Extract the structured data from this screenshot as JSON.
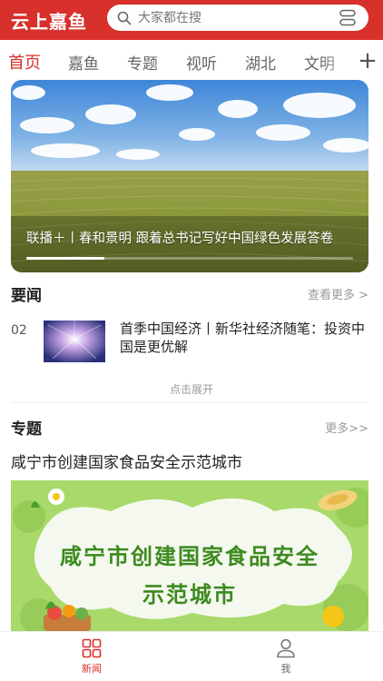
{
  "header": {
    "app_title": "云上嘉鱼",
    "search_placeholder": "大家都在搜",
    "brand_color": "#d8302b"
  },
  "tabs": [
    {
      "label": "首页",
      "active": true
    },
    {
      "label": "嘉鱼",
      "active": false
    },
    {
      "label": "专题",
      "active": false
    },
    {
      "label": "视听",
      "active": false
    },
    {
      "label": "湖北",
      "active": false
    },
    {
      "label": "文明",
      "active": false
    }
  ],
  "add_tab_icon": "plus-icon",
  "banner": {
    "caption": "联播＋丨春和景明 跟着总书记写好中国绿色发展答卷",
    "progress": 0.24
  },
  "news_section": {
    "title": "要闻",
    "more": "查看更多 >",
    "items": [
      {
        "index": "02",
        "title": "首季中国经济丨新华社经济随笔：投资中国是更优解"
      }
    ],
    "expand_label": "点击展开"
  },
  "topic_section": {
    "title": "专题",
    "more": "更多>>",
    "topic_title": "咸宁市创建国家食品安全示范城市",
    "banner_line1": "咸宁市创建国家食品安全",
    "banner_line2": "示范城市"
  },
  "bottom_nav": [
    {
      "label": "新闻",
      "icon": "grid-icon",
      "active": true
    },
    {
      "label": "我",
      "icon": "user-icon",
      "active": false
    }
  ]
}
